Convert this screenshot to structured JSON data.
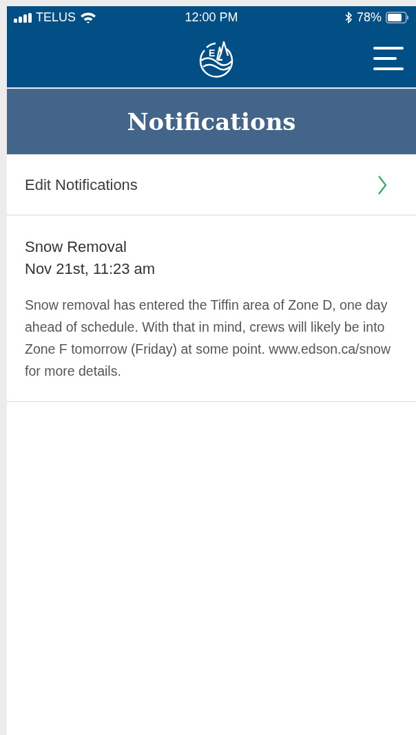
{
  "status_bar": {
    "carrier": "TELUS",
    "time": "12:00 PM",
    "battery": "78%"
  },
  "header": {
    "logo_letter": "E"
  },
  "title": "Notifications",
  "edit_row": {
    "label": "Edit Notifications"
  },
  "notifications": [
    {
      "title": "Snow Removal",
      "date": "Nov 21st, 11:23 am",
      "body": "Snow removal has entered the Tiffin area of Zone D, one day ahead of schedule. With that in mind, crews will likely be into Zone F tomorrow (Friday) at some point. www.edson.ca/snow for more details."
    }
  ]
}
